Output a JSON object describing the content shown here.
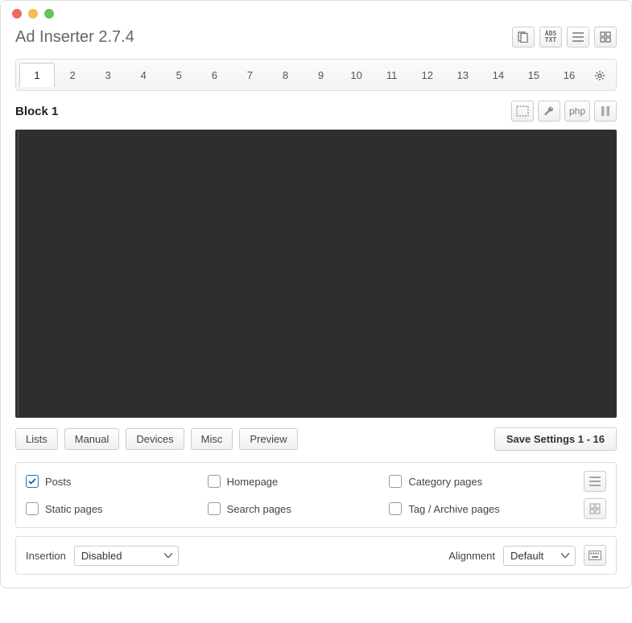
{
  "header": {
    "title": "Ad Inserter 2.7.4"
  },
  "tabs": [
    "1",
    "2",
    "3",
    "4",
    "5",
    "6",
    "7",
    "8",
    "9",
    "10",
    "11",
    "12",
    "13",
    "14",
    "15",
    "16"
  ],
  "active_tab": 0,
  "block": {
    "title": "Block 1",
    "php_label": "php"
  },
  "options": {
    "lists": "Lists",
    "manual": "Manual",
    "devices": "Devices",
    "misc": "Misc",
    "preview": "Preview",
    "save": "Save Settings 1 - 16"
  },
  "checks": {
    "posts": {
      "label": "Posts",
      "checked": true
    },
    "homepage": {
      "label": "Homepage",
      "checked": false
    },
    "category": {
      "label": "Category pages",
      "checked": false
    },
    "static": {
      "label": "Static pages",
      "checked": false
    },
    "search": {
      "label": "Search pages",
      "checked": false
    },
    "tag": {
      "label": "Tag / Archive pages",
      "checked": false
    }
  },
  "insertion": {
    "label": "Insertion",
    "value": "Disabled",
    "align_label": "Alignment",
    "align_value": "Default"
  },
  "adstxt": "ADS\nTXT"
}
